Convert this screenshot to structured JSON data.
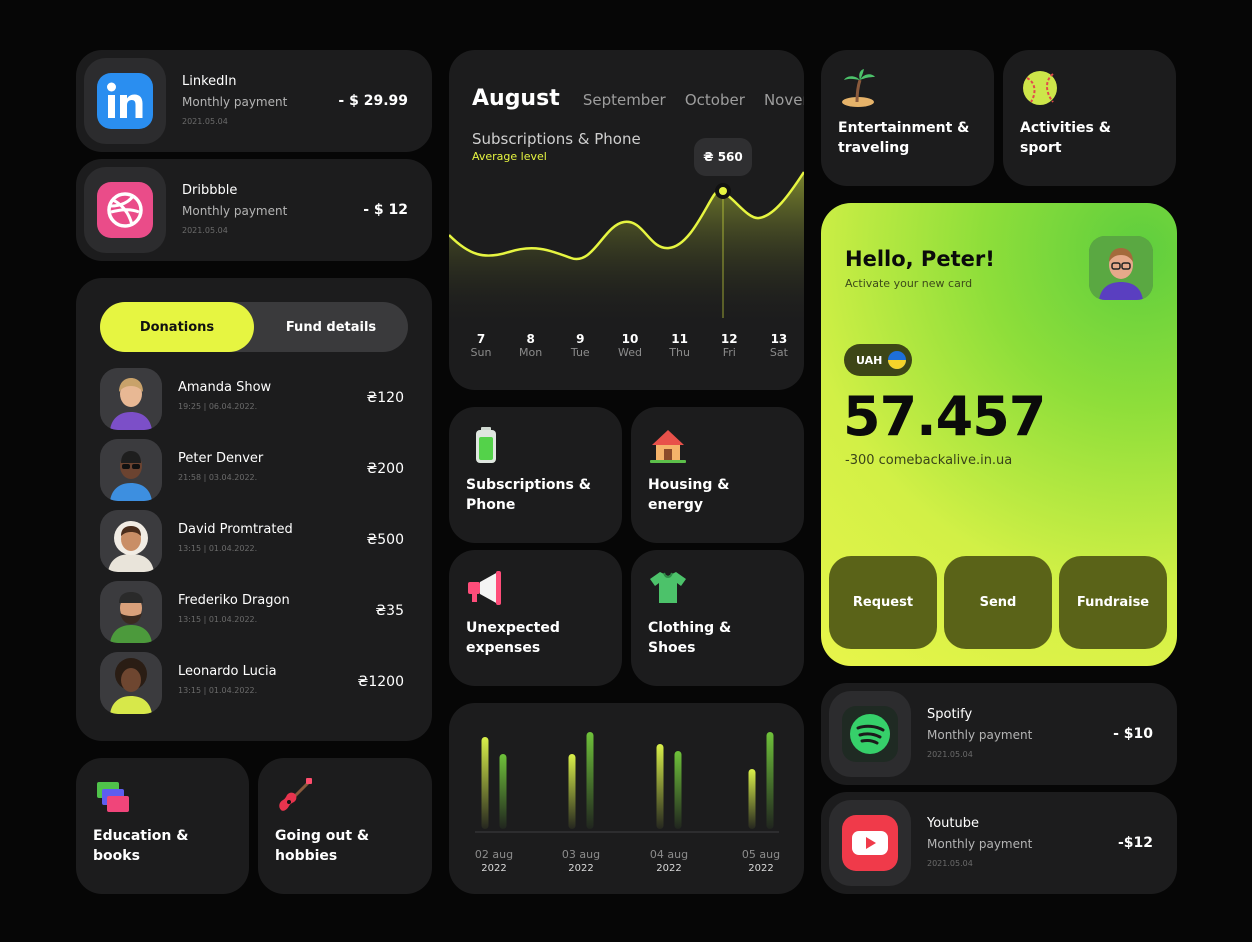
{
  "payments_left": [
    {
      "name": "LinkedIn",
      "sub": "Monthly payment",
      "date": "2021.05.04",
      "amount": "- $ 29.99",
      "icon": "linkedin-icon"
    },
    {
      "name": "Dribbble",
      "sub": "Monthly payment",
      "date": "2021.05.04",
      "amount": "- $ 12",
      "icon": "dribbble-icon"
    }
  ],
  "donations": {
    "tab_active": "Donations",
    "tab_inactive": "Fund details",
    "items": [
      {
        "name": "Amanda Show",
        "time": "19:25 | 06.04.2022.",
        "amount": "₴120"
      },
      {
        "name": "Peter Denver",
        "time": "21:58 | 03.04.2022.",
        "amount": "₴200"
      },
      {
        "name": "David Promtrated",
        "time": "13:15 | 01.04.2022.",
        "amount": "₴500"
      },
      {
        "name": "Frederiko Dragon",
        "time": "13:15 | 01.04.2022.",
        "amount": "₴35"
      },
      {
        "name": "Leonardo Lucia",
        "time": "13:15 | 01.04.2022.",
        "amount": "₴1200"
      }
    ]
  },
  "categories_bottom_left": [
    {
      "label": "Education &\nbooks",
      "icon": "books-icon"
    },
    {
      "label": "Going out &\nhobbies",
      "icon": "guitar-icon"
    }
  ],
  "line_chart_card": {
    "months": [
      "August",
      "September",
      "October",
      "Novem"
    ],
    "title": "Subscriptions & Phone",
    "subtitle": "Average level",
    "tooltip": "₴ 560",
    "days": [
      {
        "num": "7",
        "day": "Sun"
      },
      {
        "num": "8",
        "day": "Mon"
      },
      {
        "num": "9",
        "day": "Tue"
      },
      {
        "num": "10",
        "day": "Wed"
      },
      {
        "num": "11",
        "day": "Thu"
      },
      {
        "num": "12",
        "day": "Fri"
      },
      {
        "num": "13",
        "day": "Sat"
      }
    ]
  },
  "categories_middle": [
    {
      "label": "Subscriptions &\nPhone",
      "icon": "battery-icon"
    },
    {
      "label": "Housing &\nenergy",
      "icon": "house-icon"
    },
    {
      "label": "Unexpected\nexpenses",
      "icon": "megaphone-icon"
    },
    {
      "label": "Clothing &\nShoes",
      "icon": "tshirt-icon"
    }
  ],
  "chart_data": {
    "type": "bar",
    "categories": [
      "02 aug\n2022",
      "03 aug\n2022",
      "04 aug\n2022",
      "05 aug\n2022"
    ],
    "series": [
      {
        "values": [
          92,
          75,
          85,
          60
        ]
      },
      {
        "values": [
          75,
          97,
          78,
          97
        ]
      }
    ],
    "ylim": [
      0,
      100
    ],
    "colors": [
      "#d9f04a",
      "#6fc23a"
    ]
  },
  "categories_right": [
    {
      "label": "Entertainment &\ntraveling",
      "icon": "palm-island-icon"
    },
    {
      "label": "Activities &\nsport",
      "icon": "ball-icon"
    }
  ],
  "hello_card": {
    "greeting": "Hello, Peter!",
    "sub": "Activate your new card",
    "currency": "UAH",
    "balance": "57.457",
    "note": "-300 comebackalive.in.ua",
    "buttons": [
      "Request",
      "Send",
      "Fundraise"
    ]
  },
  "payments_right": [
    {
      "name": "Spotify",
      "sub": "Monthly payment",
      "date": "2021.05.04",
      "amount": "- $10",
      "icon": "spotify-icon"
    },
    {
      "name": "Youtube",
      "sub": "Monthly payment",
      "date": "2021.05.04",
      "amount": "-$12",
      "icon": "youtube-icon"
    }
  ],
  "colors": {
    "accent": "#e6f541",
    "card": "#1c1c1d",
    "background": "#060606"
  }
}
